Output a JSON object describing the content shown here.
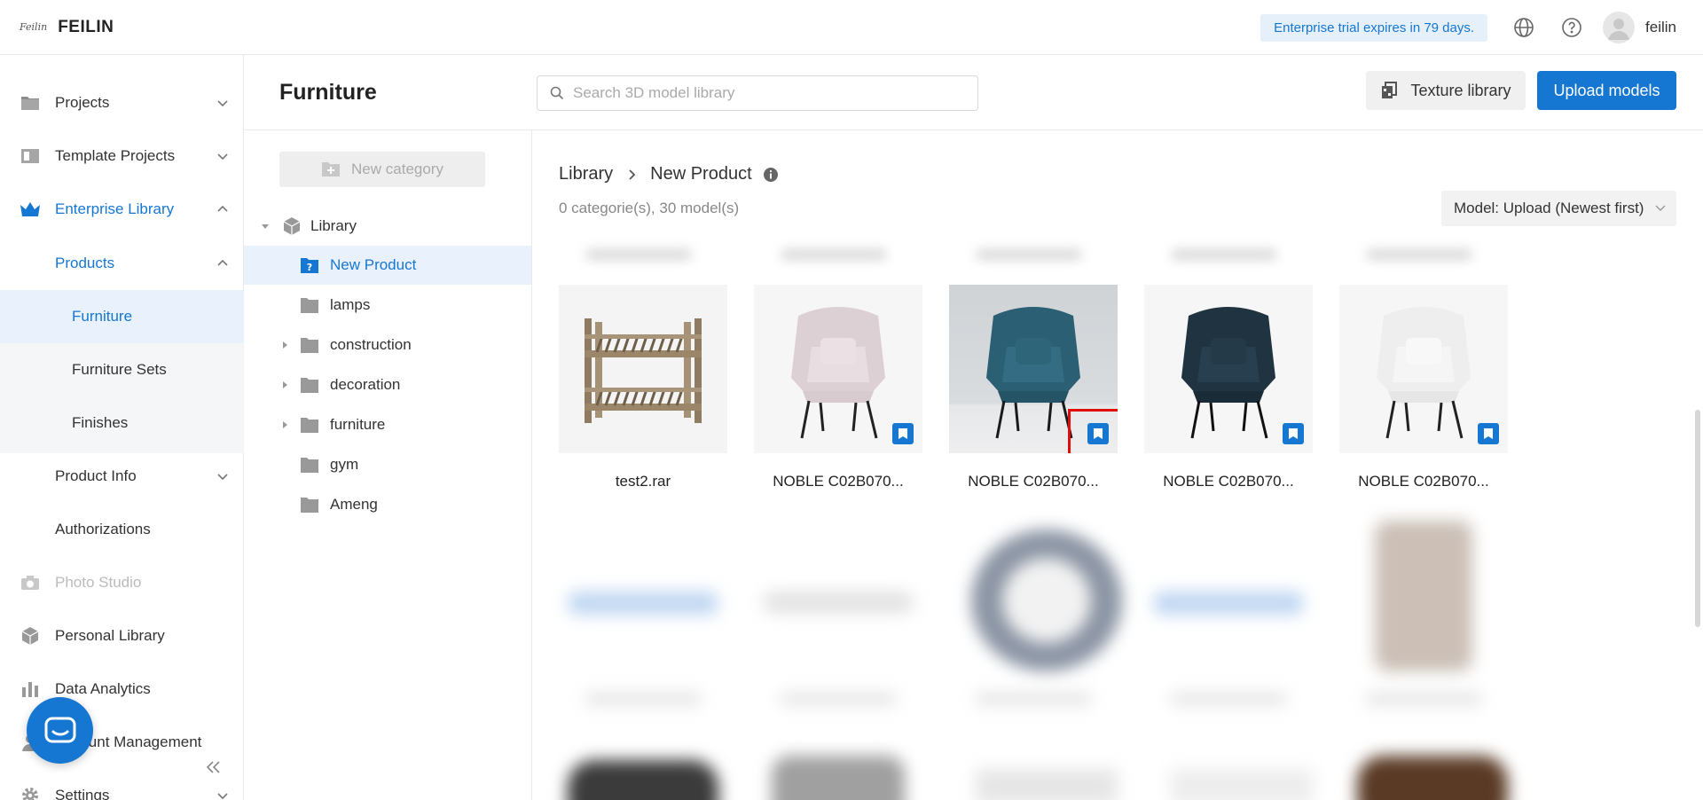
{
  "topbar": {
    "logo_mark": "Feilin",
    "brand": "FEILIN",
    "trial_notice": "Enterprise trial expires in 79 days.",
    "language_icon": "globe-icon",
    "help_icon": "question-circle-icon",
    "username": "feilin"
  },
  "sidebar": {
    "items": [
      {
        "label": "Projects",
        "icon": "folder-icon"
      },
      {
        "label": "Template Projects",
        "icon": "template-icon"
      },
      {
        "label": "Enterprise Library",
        "icon": "crown-icon"
      },
      {
        "label": "Products"
      },
      {
        "label": "Furniture"
      },
      {
        "label": "Furniture Sets"
      },
      {
        "label": "Finishes"
      },
      {
        "label": "Product Info"
      },
      {
        "label": "Authorizations"
      },
      {
        "label": "Photo Studio",
        "icon": "camera-icon"
      },
      {
        "label": "Personal Library",
        "icon": "cube-icon"
      },
      {
        "label": "Data Analytics",
        "icon": "bar-chart-icon"
      },
      {
        "label": "Account Management",
        "icon": "user-icon"
      },
      {
        "label": "Settings",
        "icon": "gear-icon"
      }
    ]
  },
  "header": {
    "title": "Furniture",
    "search_placeholder": "Search 3D model library",
    "texture_button": "Texture library",
    "upload_button": "Upload models"
  },
  "tree": {
    "new_category": "New category",
    "root": "Library",
    "nodes": [
      "New Product",
      "lamps",
      "construction",
      "decoration",
      "furniture",
      "gym",
      "Ameng"
    ]
  },
  "content": {
    "breadcrumb_root": "Library",
    "breadcrumb_current": "New Product",
    "counts": "0 categorie(s), 30 model(s)",
    "sort_label": "Model: Upload (Newest first)",
    "models": [
      {
        "name": "test2.rar"
      },
      {
        "name": "NOBLE C02B070..."
      },
      {
        "name": "NOBLE C02B070..."
      },
      {
        "name": "NOBLE C02B070..."
      },
      {
        "name": "NOBLE C02B070..."
      }
    ]
  },
  "colors": {
    "accent": "#1677d2",
    "highlight": "#e10d0d"
  }
}
